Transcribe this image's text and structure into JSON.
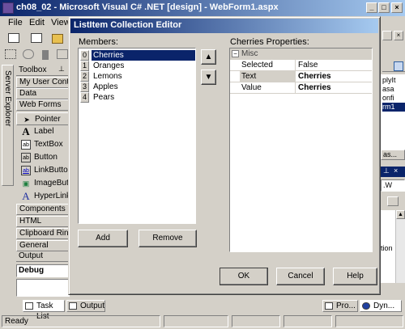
{
  "main_window": {
    "title": "ch08_02 - Microsoft Visual C# .NET [design] - WebForm1.aspx"
  },
  "menubar": {
    "items": [
      "File",
      "Edit",
      "View"
    ]
  },
  "server_explorer": {
    "label": "Server Explorer"
  },
  "toolbox": {
    "title": "Toolbox",
    "tabs_top": [
      "My User Controls",
      "Data",
      "Web Forms"
    ],
    "items": [
      {
        "label": "Pointer",
        "icon": "pointer-icon",
        "glyph": "➤"
      },
      {
        "label": "Label",
        "icon": "label-icon",
        "glyph": "A"
      },
      {
        "label": "TextBox",
        "icon": "textbox-icon",
        "glyph": "ab"
      },
      {
        "label": "Button",
        "icon": "button-icon",
        "glyph": "ab"
      },
      {
        "label": "LinkButton",
        "icon": "linkbutton-icon",
        "glyph": "ab"
      },
      {
        "label": "ImageButton",
        "icon": "imagebutton-icon",
        "glyph": "▣"
      },
      {
        "label": "HyperLink",
        "icon": "hyperlink-icon",
        "glyph": "A"
      }
    ],
    "tabs_bottom": [
      "Components",
      "HTML",
      "Clipboard Ring",
      "General"
    ]
  },
  "output_panel": {
    "title": "Output",
    "dropdown": "Debug"
  },
  "dialog": {
    "title": "ListItem Collection Editor",
    "members_label": "Members:",
    "members": [
      {
        "index": "0",
        "label": "Cherries"
      },
      {
        "index": "1",
        "label": "Oranges"
      },
      {
        "index": "2",
        "label": "Lemons"
      },
      {
        "index": "3",
        "label": "Apples"
      },
      {
        "index": "4",
        "label": "Pears"
      }
    ],
    "properties_label": "Cherries Properties:",
    "category": "Misc",
    "properties": [
      {
        "name": "Selected",
        "value": "False",
        "bold": false
      },
      {
        "name": "Text",
        "value": "Cherries",
        "bold": true
      },
      {
        "name": "Value",
        "value": "Cherries",
        "bold": true
      }
    ],
    "add_label": "Add",
    "remove_label": "Remove",
    "ok_label": "OK",
    "cancel_label": "Cancel",
    "help_label": "Help"
  },
  "right_panel": {
    "fragments": [
      "plyIt",
      "asa",
      "onfi",
      "rm1",
      "as...",
      ".W",
      "tion"
    ]
  },
  "bottom_tabs": [
    "Task List",
    "Output"
  ],
  "bottom_right_tabs": [
    "Pro...",
    "Dyn..."
  ],
  "status": {
    "text": "Ready"
  },
  "colors": {
    "title_active": "#0a246a",
    "title_gradient_end": "#a6caf0",
    "selection": "#0a246a",
    "face": "#d4d0c8"
  }
}
